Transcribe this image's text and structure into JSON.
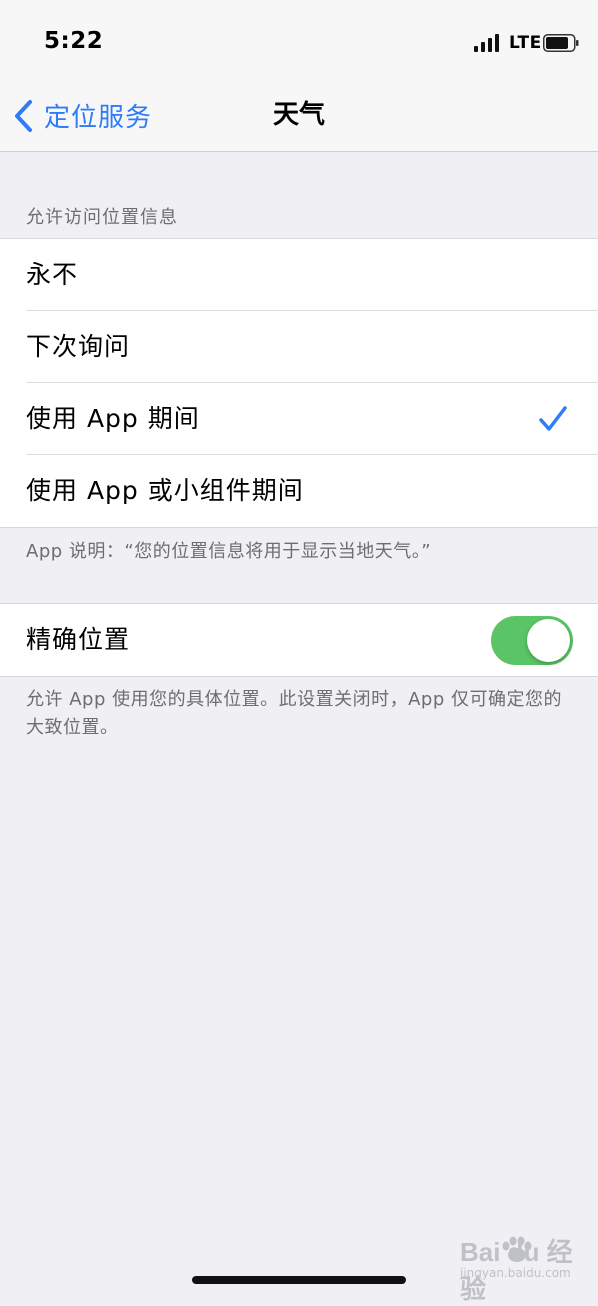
{
  "status_bar": {
    "time": "5:22",
    "network": "LTE"
  },
  "nav": {
    "back_label": "定位服务",
    "title": "天气"
  },
  "location_access": {
    "header": "允许访问位置信息",
    "options": [
      {
        "label": "永不",
        "selected": false
      },
      {
        "label": "下次询问",
        "selected": false
      },
      {
        "label": "使用 App 期间",
        "selected": true
      },
      {
        "label": "使用 App 或小组件期间",
        "selected": false
      }
    ],
    "footer": "App 说明：“您的位置信息将用于显示当地天气。”"
  },
  "precise_location": {
    "label": "精确位置",
    "enabled": true,
    "footer": "允许 App 使用您的具体位置。此设置关闭时，App 仅可确定您的大致位置。"
  },
  "watermark": {
    "brand": "Bai du 经验",
    "sub": "jingyan.baidu.com"
  },
  "colors": {
    "accent": "#2f7cf6",
    "toggle_on": "#5ac466",
    "background": "#f0f0f4"
  }
}
